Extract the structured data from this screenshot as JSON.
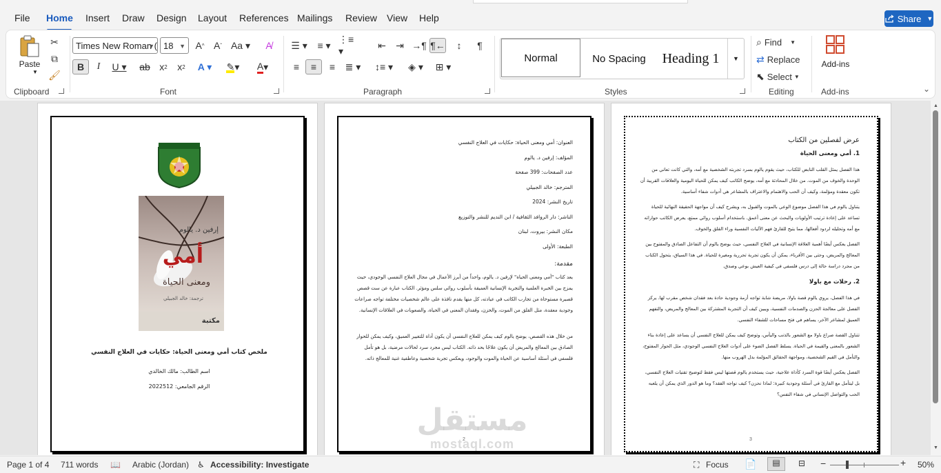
{
  "menu": {
    "tabs": [
      "File",
      "Home",
      "Insert",
      "Draw",
      "Design",
      "Layout",
      "References",
      "Mailings",
      "Review",
      "View",
      "Help"
    ],
    "share": "Share"
  },
  "ribbon": {
    "clipboard": {
      "label": "Clipboard",
      "paste": "Paste"
    },
    "font": {
      "label": "Font",
      "name": "Times New Roman (",
      "size": "18"
    },
    "paragraph": {
      "label": "Paragraph"
    },
    "styles": {
      "label": "Styles",
      "items": [
        "Normal",
        "No Spacing",
        "Heading 1"
      ]
    },
    "editing": {
      "label": "Editing",
      "find": "Find",
      "replace": "Replace",
      "select": "Select"
    },
    "addins": {
      "label": "Add-ins",
      "button": "Add-ins"
    }
  },
  "doc": {
    "page1": {
      "title": "ملخص كتاب أمي ومعنى الحياة: حكايات في العلاج النفسي",
      "student": "اسم الطالب: مالك الخالدي",
      "id": "الرقم الجامعي: 2022512",
      "cover_author": "إرفين د. يالوم",
      "cover_title1": "أمي",
      "cover_title2": "ومعنى الحياة",
      "cover_translator": "ترجمة: خالد الجبيلي",
      "cover_publisher": "مكتبة"
    },
    "page2": {
      "meta": [
        "العنوان: أمي ومعنى الحياة: حكايات في العلاج النفسي",
        "المؤلف: إرفين د. يالوم",
        "عدد الصفحات: 399 صفحة",
        "المترجم: خالد الجبيلي",
        "تاريخ النشر: 2024",
        "الناشر: دار الروافد الثقافية / ابن النديم للنشر والتوزيع",
        "مكان النشر: بيروت، لبنان",
        "الطبعة: الأولى"
      ],
      "intro_heading": "مقدمة:",
      "intro_p1": "يعد كتاب \"أمي ومعنى الحياة\" لإرفين د. يالوم، واحداً من أبرز الأعمال في مجال العلاج النفسي الوجودي، حيث يمزج بين الخبرة العلمية والتجربة الإنسانية العميقة بأسلوب روائي سلس ومؤثر. الكتاب عبارة عن ست قصص قصيرة مستوحاة من تجارب الكاتب في عيادته، كل منها يقدم نافذة على عالم شخصيات مختلفة تواجه صراعات وجودية معقدة، مثل القلق من الموت، والحزن، وفقدان المعنى في الحياة، والصعوبات في العلاقات الإنسانية.",
      "intro_p2": "من خلال هذه القصص، يوضح يالوم كيف يمكن للعلاج النفسي أن يكون أداة للتغيير العميق، وكيف يمكن للحوار الصادق بين المعالج والمريض أن يكون علاجًا بحد ذاته. الكتاب ليس مجرد سرد لحالات مرضية، بل هو تأمل فلسفي في أسئلة أساسية عن الحياة والموت والوجود، ويعكس تجربة شخصية وعاطفية غنية للمعالج ذاته.",
      "page_number": "2"
    },
    "page3": {
      "heading": "عرض لفصلين من الكتاب",
      "ch1_title": "1. أمي ومعنى الحياة",
      "ch1_p1": "هذا الفصل يمثل القلب النابض للكتاب، حيث يقوم يالوم بسرد تجربته الشخصية مع أمه، والتي كانت تعاني من الوحدة والخوف من الموت. من خلال المحادثة مع أمه، يوضح الكاتب كيف يمكن للحياة اليومية والعلاقات القريبة أن تكون معقدة ومؤلمة، وكيف أن الحب والاهتمام والاعتراف بالمشاعر هي أدوات شفاء أساسية.",
      "ch1_p2": "يتناول يالوم في هذا الفصل موضوع الوعي بالموت والقبول به، ويشرح كيف أن مواجهة الحقيقة النهائية للحياة تساعد على إعادة ترتيب الأولويات والبحث عن معنى أعمق. باستخدام أسلوب روائي ممتع، يعرض الكاتب حواراته مع أمه وتحليله لردود أفعالها، مما يتيح للقارئ فهم الآليات النفسية وراء القلق والخوف.",
      "ch1_p3": "الفصل يعكس أيضًا أهمية العلاقة الإنسانية في العلاج النفسي، حيث يوضح يالوم أن التفاعل الصادق والمفتوح بين المعالج والمريض، وحتى بين الأقرباء، يمكن أن يكون تجربة تحررية ومغيرة للحياة. في هذا السياق، يتحول الكتاب من مجرد دراسة حالة إلى درس فلسفي في كيفية العيش بوعي وصدق.",
      "ch2_title": "2. رحلات مع باولا",
      "ch2_p1": "في هذا الفصل، يروي يالوم قصة باولا، مريضة شابة تواجه أزمة وجودية حادة بعد فقدان شخص مقرب لها. يركز الفصل على معالجة الحزن والصدمات النفسية، ويبين كيف أن التجربة المشتركة بين المعالج والمريض، والتفهم العميق لمشاعر الآخر، يساهم في فتح مساحات للشفاء النفسي.",
      "ch2_p2": "تتناول القصة صراع باولا مع الشعور بالذنب واليأس، وتوضح كيف يمكن للعلاج النفسي أن يساعد على إعادة بناء الشعور بالمعنى والقيمة في الحياة. يسلط الفصل الضوء على أدوات العلاج النفسي الوجودي، مثل الحوار المفتوح، والتأمل في القيم الشخصية، ومواجهة الحقائق المؤلمة بدل الهروب منها.",
      "ch2_p3": "الفصل يعكس أيضًا قوة السرد كأداة علاجية، حيث يستخدم يالوم قصتها ليس فقط لتوضيح تقنيات العلاج النفسي، بل ليتأمل مع القارئ في أسئلة وجودية كبيرة: لماذا نحزن؟ كيف نواجه الفقد؟ وما هو الدور الذي يمكن أن يلعبه الحب والتواصل الإنساني في شفاء النفس؟",
      "page_number": "3"
    },
    "watermark": "مستقل",
    "watermark_latin": "mostaql.com"
  },
  "status": {
    "page": "Page 1 of 4",
    "words": "711 words",
    "language": "Arabic (Jordan)",
    "accessibility": "Accessibility: Investigate",
    "focus": "Focus",
    "zoom": "50%"
  }
}
